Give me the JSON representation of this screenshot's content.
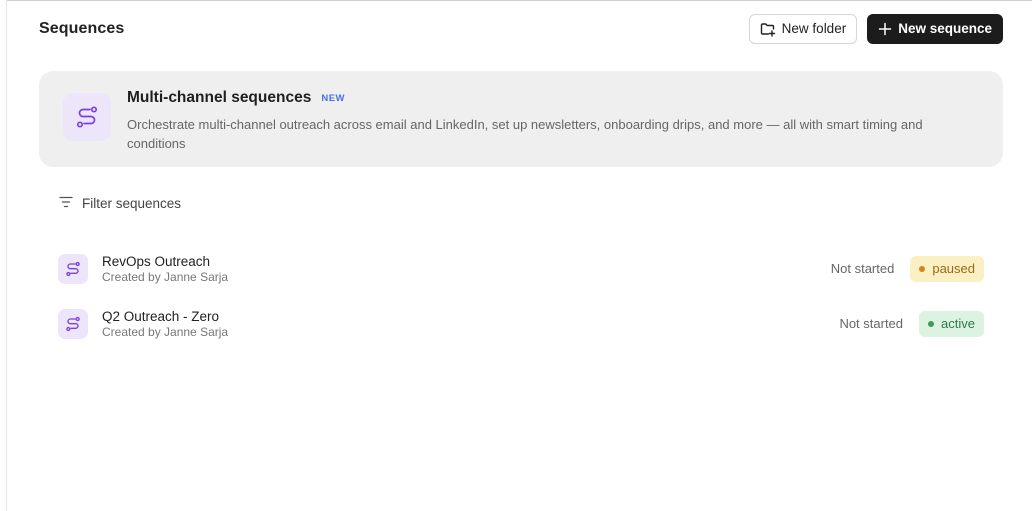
{
  "header": {
    "title": "Sequences",
    "new_folder_label": "New folder",
    "new_sequence_label": "New sequence"
  },
  "promo": {
    "title": "Multi-channel sequences",
    "badge": "NEW",
    "description": "Orchestrate multi-channel outreach across email and LinkedIn, set up newsletters, onboarding drips, and more — all with smart timing and conditions",
    "icon": "sequence-route-icon"
  },
  "filter": {
    "label": "Filter sequences",
    "icon": "filter-lines-icon"
  },
  "sequences": [
    {
      "name": "RevOps Outreach",
      "created_by": "Created by Janne Sarja",
      "progress": "Not started",
      "state": "paused",
      "state_bg": "#fbefc4",
      "state_fg": "#9a6a12",
      "state_dot": "#c98a1a"
    },
    {
      "name": "Q2 Outreach - Zero",
      "created_by": "Created by Janne Sarja",
      "progress": "Not started",
      "state": "active",
      "state_bg": "#dcf3e2",
      "state_fg": "#2f7a47",
      "state_dot": "#3e9a5a"
    }
  ],
  "colors": {
    "accent_purple": "#7b3fe0",
    "icon_tile_bg": "#ede6fb",
    "dark_button": "#1c1c1c"
  }
}
